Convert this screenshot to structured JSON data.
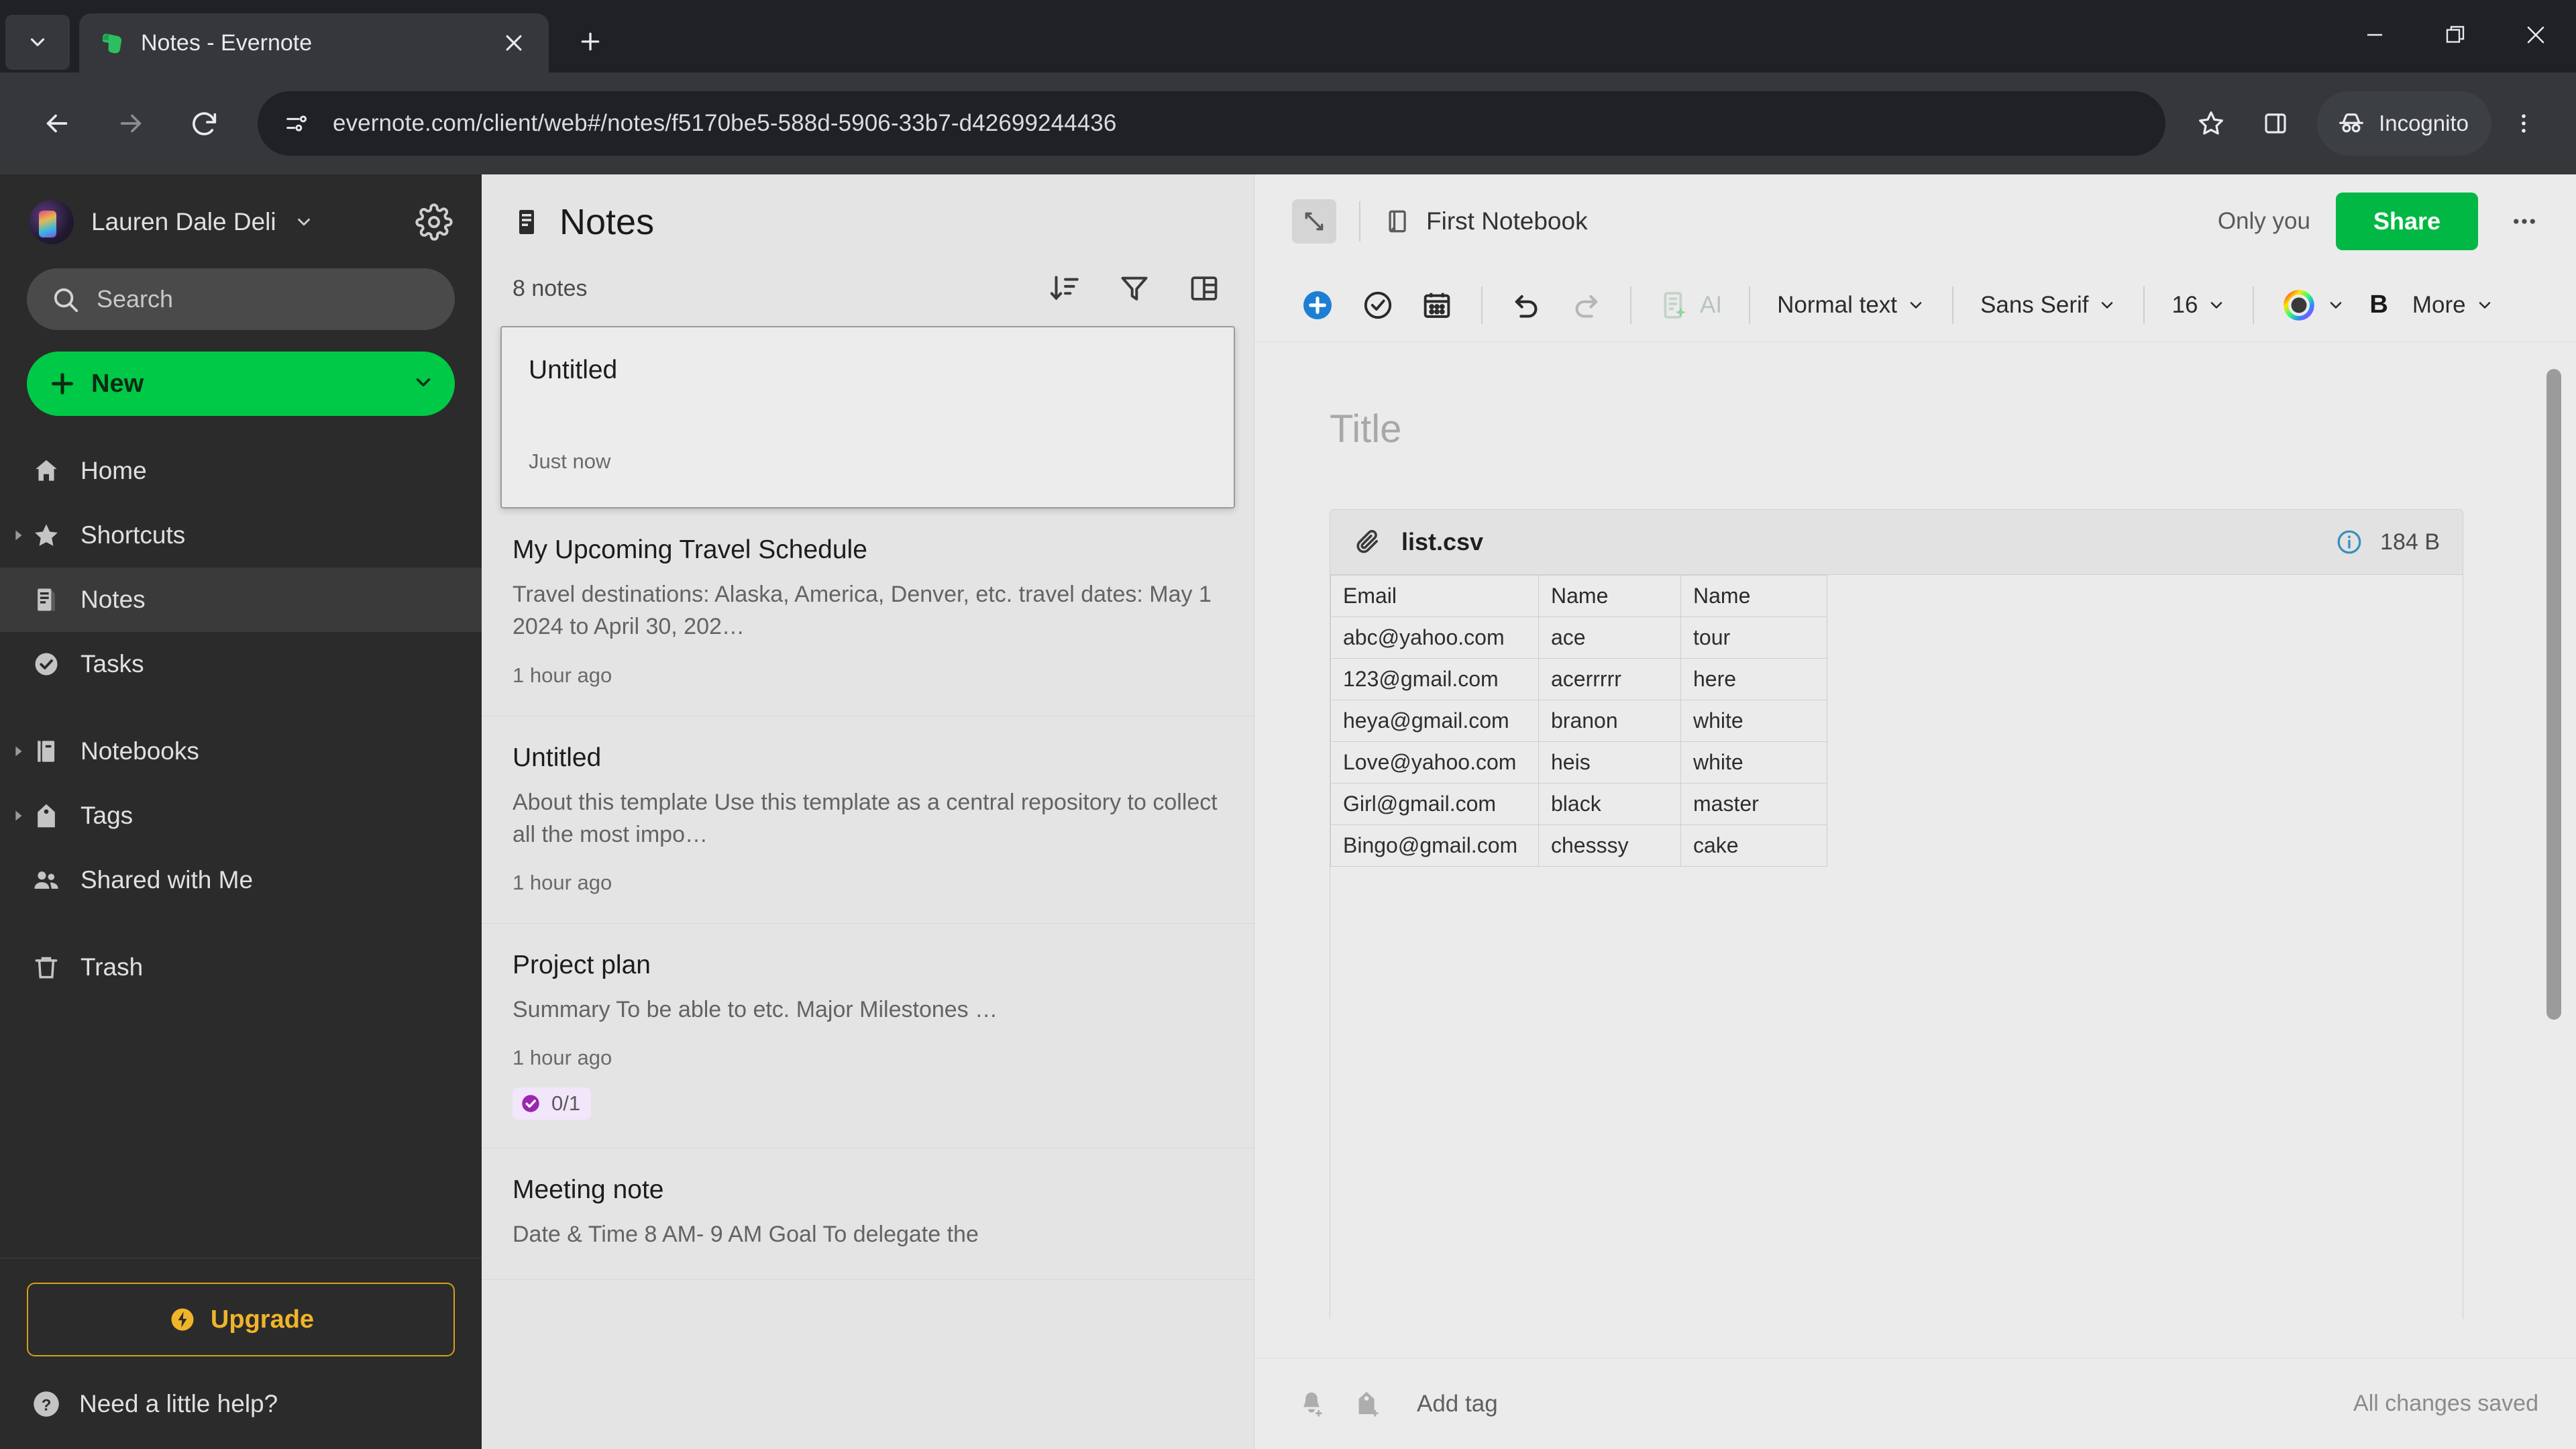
{
  "browser": {
    "tab": {
      "title": "Notes - Evernote",
      "favicon": "evernote-elephant-icon"
    },
    "url": "evernote.com/client/web#/notes/f5170be5-588d-5906-33b7-d42699244436",
    "profile_label": "Incognito"
  },
  "sidebar": {
    "username": "Lauren Dale Deli",
    "search_placeholder": "Search",
    "new_label": "New",
    "items": [
      {
        "label": "Home",
        "icon": "home-icon",
        "twisty": false,
        "active": false
      },
      {
        "label": "Shortcuts",
        "icon": "star-icon",
        "twisty": true,
        "active": false
      },
      {
        "label": "Notes",
        "icon": "note-icon",
        "twisty": false,
        "active": true
      },
      {
        "label": "Tasks",
        "icon": "check-circle-icon",
        "twisty": false,
        "active": false
      },
      {
        "label": "Notebooks",
        "icon": "notebook-icon",
        "twisty": true,
        "active": false
      },
      {
        "label": "Tags",
        "icon": "tag-icon",
        "twisty": true,
        "active": false
      },
      {
        "label": "Shared with Me",
        "icon": "people-icon",
        "twisty": false,
        "active": false
      },
      {
        "label": "Trash",
        "icon": "trash-icon",
        "twisty": false,
        "active": false
      }
    ],
    "upgrade_label": "Upgrade",
    "help_label": "Need a little help?"
  },
  "notes_list": {
    "title": "Notes",
    "count_label": "8 notes",
    "notes": [
      {
        "title": "Untitled",
        "snippet": "",
        "time": "Just now",
        "selected": true,
        "task_badge": null
      },
      {
        "title": "My Upcoming Travel Schedule",
        "snippet": "Travel destinations: Alaska, America, Denver, etc. travel dates: May 1 2024 to April 30, 202…",
        "time": "1 hour ago",
        "selected": false,
        "task_badge": null
      },
      {
        "title": "Untitled",
        "snippet": "About this template Use this template as a central repository to collect all the most impo…",
        "time": "1 hour ago",
        "selected": false,
        "task_badge": null
      },
      {
        "title": "Project plan",
        "snippet": "Summary To be able to etc. Major Milestones …",
        "time": "1 hour ago",
        "selected": false,
        "task_badge": "0/1"
      },
      {
        "title": "Meeting note",
        "snippet": "Date & Time 8 AM- 9 AM Goal To delegate the",
        "time": "",
        "selected": false,
        "task_badge": null
      }
    ]
  },
  "editor": {
    "notebook": "First Notebook",
    "only_you": "Only you",
    "share_label": "Share",
    "title_placeholder": "Title",
    "toolbar": {
      "paragraph_style": "Normal text",
      "font_family": "Sans Serif",
      "font_size": "16",
      "ai_label": "AI",
      "bold_label": "B",
      "more_label": "More"
    },
    "attachment": {
      "filename": "list.csv",
      "size": "184 B"
    },
    "add_tag": "Add tag",
    "save_status": "All changes saved"
  },
  "csv_table": {
    "headers": [
      "Email",
      "Name",
      "Name"
    ],
    "rows": [
      [
        "abc@yahoo.com",
        "ace",
        "tour"
      ],
      [
        "123@gmail.com",
        "acerrrrr",
        "here"
      ],
      [
        "heya@gmail.com",
        "branon",
        "white"
      ],
      [
        "Love@yahoo.com",
        "heis",
        "white"
      ],
      [
        "Girl@gmail.com",
        "black",
        "master"
      ],
      [
        "Bingo@gmail.com",
        "chesssy",
        "cake"
      ]
    ]
  },
  "colors": {
    "evernote_green": "#00c947",
    "share_green": "#00b843",
    "upgrade_gold": "#f0b429",
    "task_purple": "#9b27b0",
    "browser_dark": "#202124"
  }
}
